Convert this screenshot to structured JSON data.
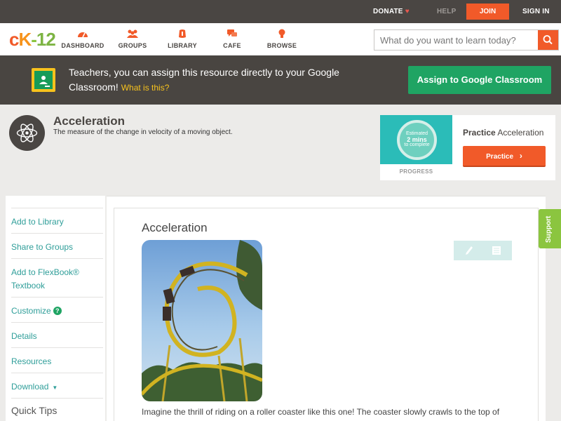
{
  "topbar": {
    "donate": "DONATE",
    "help": "HELP",
    "join": "JOIN",
    "signin": "SIGN IN"
  },
  "nav": {
    "logo": {
      "c": "c",
      "k": "K",
      "dash": "-",
      "n12": "12"
    },
    "items": [
      {
        "label": "DASHBOARD",
        "icon": "dashboard-icon"
      },
      {
        "label": "GROUPS",
        "icon": "groups-icon"
      },
      {
        "label": "LIBRARY",
        "icon": "library-icon"
      },
      {
        "label": "CAFE",
        "icon": "cafe-icon"
      },
      {
        "label": "BROWSE",
        "icon": "browse-icon"
      }
    ],
    "search_placeholder": "What do you want to learn today?"
  },
  "banner": {
    "text": "Teachers, you can assign this resource directly to your Google Classroom!",
    "link": "What is this?",
    "button": "Assign to Google Classroom"
  },
  "concept": {
    "title": "Acceleration",
    "subtitle": "The measure of the change in velocity of a moving object."
  },
  "practice_card": {
    "estimated": "Estimated",
    "mins": "2 mins",
    "to_complete": "to complete",
    "progress_label": "PROGRESS",
    "practice_word": "Practice",
    "topic": "Acceleration",
    "button": "Practice"
  },
  "sidebar": {
    "items": [
      {
        "label": "Add to Library"
      },
      {
        "label": "Share to Groups"
      },
      {
        "label": "Add to FlexBook® Textbook"
      },
      {
        "label": "Customize"
      },
      {
        "label": "Details"
      },
      {
        "label": "Resources"
      },
      {
        "label": "Download"
      }
    ],
    "quick_tips": "Quick Tips"
  },
  "content": {
    "title": "Acceleration",
    "paragraph": "Imagine the thrill of riding on a roller coaster like this one! The coaster slowly crawls to the top of"
  },
  "support": "Support",
  "colors": {
    "brand_orange": "#f15a29",
    "brand_green": "#1fa463",
    "teal_link": "#2f9e99",
    "dark_bar": "#4a4643"
  }
}
